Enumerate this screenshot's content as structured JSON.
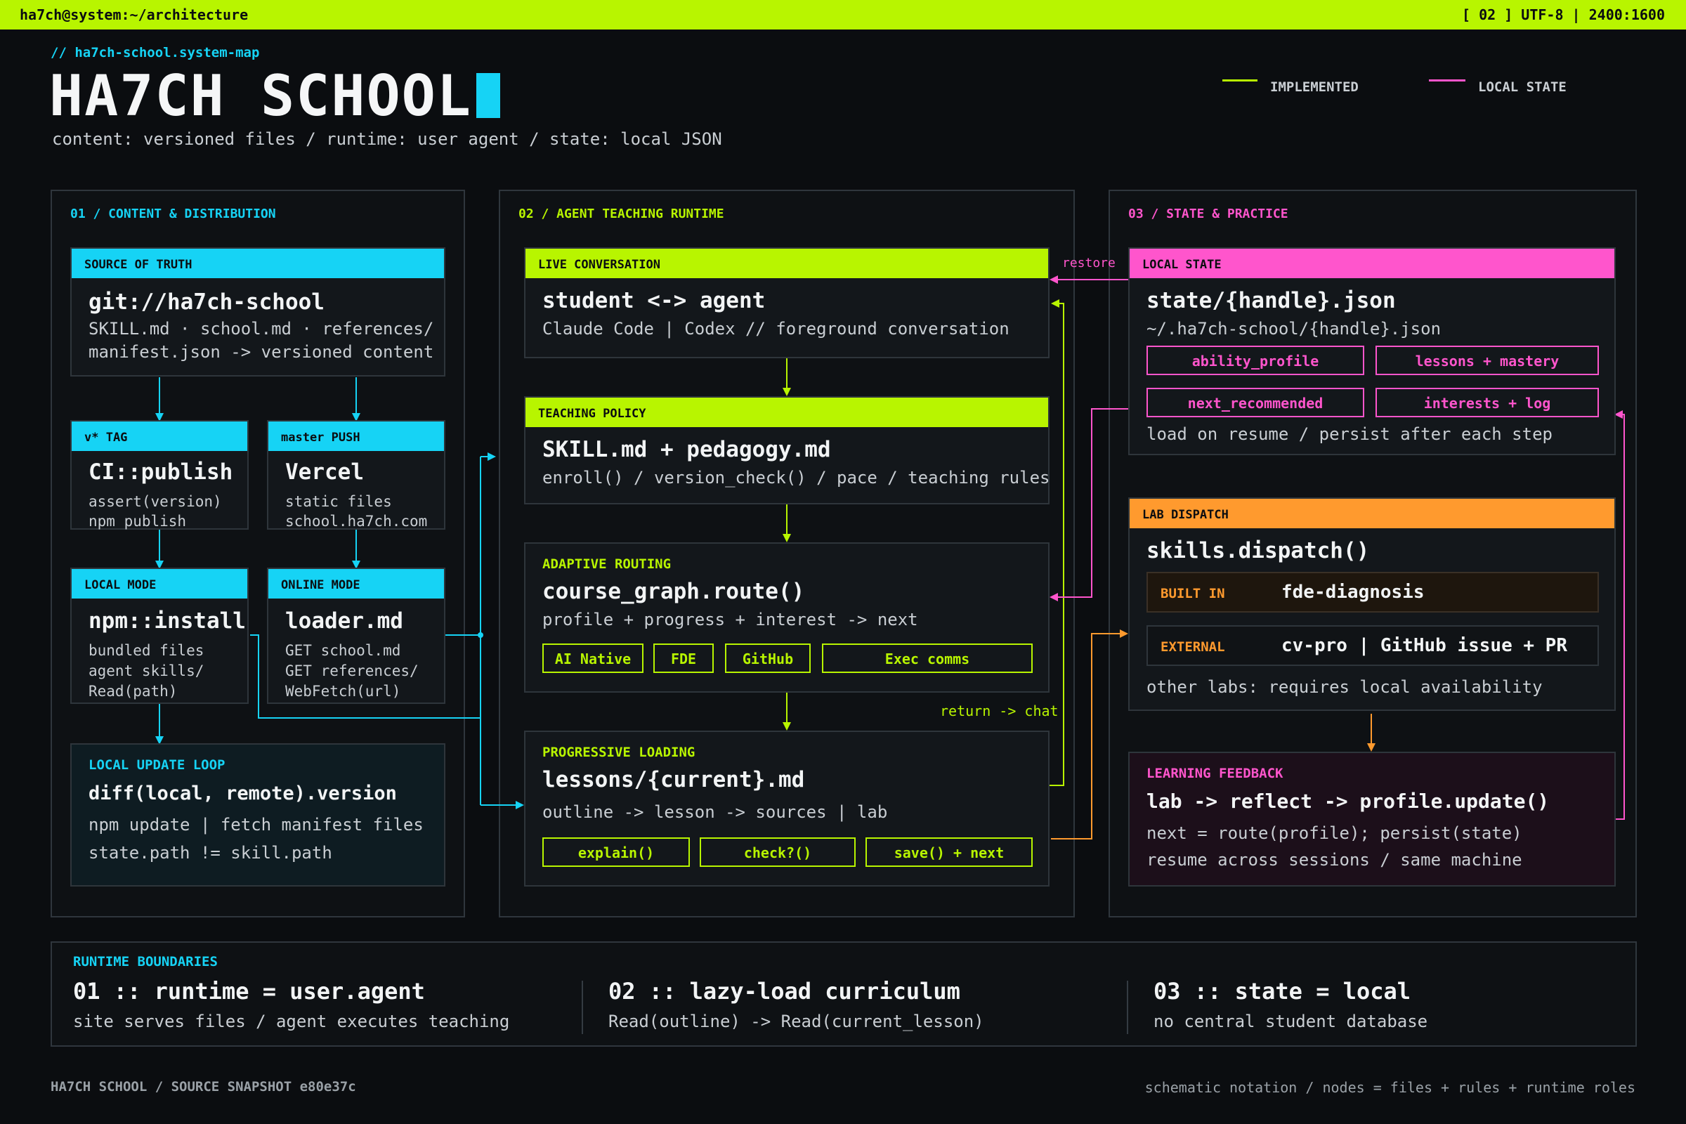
{
  "topbar": {
    "left": "ha7ch@system:~/architecture",
    "right": "[ 02 ] UTF-8 | 2400:1600"
  },
  "header": {
    "path": "// ha7ch-school.system-map",
    "title": "HA7CH SCHOOL",
    "subtitle": "content: versioned files / runtime: user agent / state: local JSON"
  },
  "legend": {
    "implemented": "IMPLEMENTED",
    "local_state": "LOCAL STATE"
  },
  "panel1": {
    "title": "01 / CONTENT & DISTRIBUTION",
    "source": {
      "header": "SOURCE OF TRUTH",
      "title": "git://ha7ch-school",
      "line1": "SKILL.md · school.md · references/",
      "line2": "manifest.json -> versioned content"
    },
    "tag": {
      "header": "v* TAG",
      "title": "CI::publish",
      "line1": "assert(version)",
      "line2": "npm publish"
    },
    "push": {
      "header": "master PUSH",
      "title": "Vercel",
      "line1": "static files",
      "line2": "school.ha7ch.com"
    },
    "local": {
      "header": "LOCAL MODE",
      "title": "npm::install",
      "line1": "bundled files",
      "line2": "agent skills/",
      "line3": "Read(path)"
    },
    "online": {
      "header": "ONLINE MODE",
      "title": "loader.md",
      "line1": "GET school.md",
      "line2": "GET references/",
      "line3": "WebFetch(url)"
    },
    "update": {
      "header": "LOCAL UPDATE LOOP",
      "title": "diff(local, remote).version",
      "line1": "npm update | fetch manifest files",
      "line2": "state.path != skill.path"
    }
  },
  "panel2": {
    "title": "02 / AGENT TEACHING RUNTIME",
    "live": {
      "header": "LIVE CONVERSATION",
      "title": "student <-> agent",
      "line1": "Claude Code | Codex // foreground conversation"
    },
    "policy": {
      "header": "TEACHING POLICY",
      "title": "SKILL.md + pedagogy.md",
      "line1": "enroll() / version_check() / pace / teaching rules"
    },
    "routing": {
      "header": "ADAPTIVE ROUTING",
      "title": "course_graph.route()",
      "line1": "profile + progress + interest -> next",
      "chips": [
        "AI Native",
        "FDE",
        "GitHub",
        "Exec comms"
      ]
    },
    "loading": {
      "header": "PROGRESSIVE LOADING",
      "title": "lessons/{current}.md",
      "line1": "outline -> lesson -> sources | lab",
      "chips": [
        "explain()",
        "check?()",
        "save() + next"
      ]
    },
    "return_label": "return -> chat",
    "restore_label": "restore"
  },
  "panel3": {
    "title": "03 / STATE & PRACTICE",
    "state": {
      "header": "LOCAL STATE",
      "title": "state/{handle}.json",
      "line1": "~/.ha7ch-school/{handle}.json",
      "chips": [
        "ability_profile",
        "lessons + mastery",
        "next_recommended",
        "interests + log"
      ],
      "line2": "load on resume / persist after each step"
    },
    "lab": {
      "header": "LAB DISPATCH",
      "title": "skills.dispatch()",
      "builtin_label": "BUILT IN",
      "builtin_value": "fde-diagnosis",
      "external_label": "EXTERNAL",
      "external_value": "cv-pro | GitHub issue + PR",
      "line1": "other labs: requires local availability"
    },
    "feedback": {
      "header": "LEARNING FEEDBACK",
      "title": "lab -> reflect -> profile.update()",
      "line1": "next = route(profile); persist(state)",
      "line2": "resume across sessions / same machine"
    }
  },
  "boundaries": {
    "title": "RUNTIME BOUNDARIES",
    "items": [
      {
        "title": "01 :: runtime = user.agent",
        "line": "site serves files / agent executes teaching"
      },
      {
        "title": "02 :: lazy-load curriculum",
        "line": "Read(outline) -> Read(current_lesson)"
      },
      {
        "title": "03 :: state = local",
        "line": "no central student database"
      }
    ]
  },
  "footer": {
    "left": "HA7CH SCHOOL / SOURCE SNAPSHOT e80e37c",
    "right": "schematic notation / nodes = files + rules + runtime roles"
  },
  "colors": {
    "lime": "#b8f500",
    "cyan": "#16d3f5",
    "pink": "#ff55cc",
    "orange": "#ff9a2e",
    "bg": "#0b0d10"
  }
}
